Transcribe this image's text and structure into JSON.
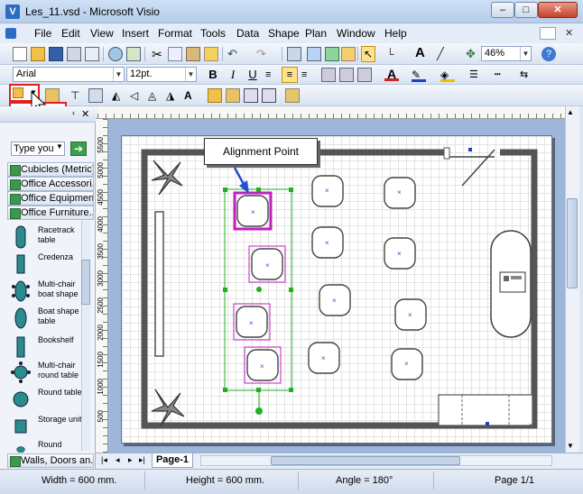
{
  "window": {
    "title": "Les_11.vsd - Microsoft Visio",
    "app_icon": "V",
    "minimize": "–",
    "maximize": "□",
    "close": "✕"
  },
  "menu": {
    "items": [
      {
        "label": "File"
      },
      {
        "label": "Edit"
      },
      {
        "label": "View"
      },
      {
        "label": "Insert"
      },
      {
        "label": "Format"
      },
      {
        "label": "Tools"
      },
      {
        "label": "Data"
      },
      {
        "label": "Shape"
      },
      {
        "label": "Plan"
      },
      {
        "label": "Window"
      },
      {
        "label": "Help"
      }
    ],
    "help_close": "✕"
  },
  "toolbar": {
    "zoom": "46%",
    "font_name": "Arial",
    "font_size": "12pt.",
    "bold": "B",
    "italic": "I",
    "underline": "U",
    "font_color_letter": "A",
    "text_tool_letter": "A"
  },
  "shapes_panel": {
    "search_placeholder": "Type you",
    "stencils": [
      "Cubicles (Metric)",
      "Office Accessori...",
      "Office Equipmen...",
      "Office Furniture..."
    ],
    "bottom_stencil": "Walls, Doors an...",
    "items": [
      {
        "label": "Racetrack table"
      },
      {
        "label": "Credenza"
      },
      {
        "label": "Multi-chair boat shape"
      },
      {
        "label": "Boat shape table"
      },
      {
        "label": "Bookshelf"
      },
      {
        "label": "Multi-chair round table"
      },
      {
        "label": "Round table"
      },
      {
        "label": "Storage unit"
      },
      {
        "label": "Round"
      }
    ]
  },
  "rulers": {
    "left_labels": [
      "5500",
      "5000",
      "4500",
      "4000",
      "3500",
      "3000",
      "2500",
      "2000",
      "1500",
      "1000",
      "500"
    ]
  },
  "drawing": {
    "callout": "Alignment Point"
  },
  "page_tabs": {
    "nav": [
      "|◂",
      "◂",
      "▸",
      "▸|"
    ],
    "current": "Page-1"
  },
  "status": {
    "width": "Width = 600 mm.",
    "height": "Height = 600 mm.",
    "angle": "Angle = 180°",
    "page": "Page 1/1"
  },
  "colors": {
    "selection_magenta": "#c020c0",
    "selection_green": "#20b020",
    "highlight_red": "#e0201e",
    "canvas_bg": "#9eb6d9"
  }
}
